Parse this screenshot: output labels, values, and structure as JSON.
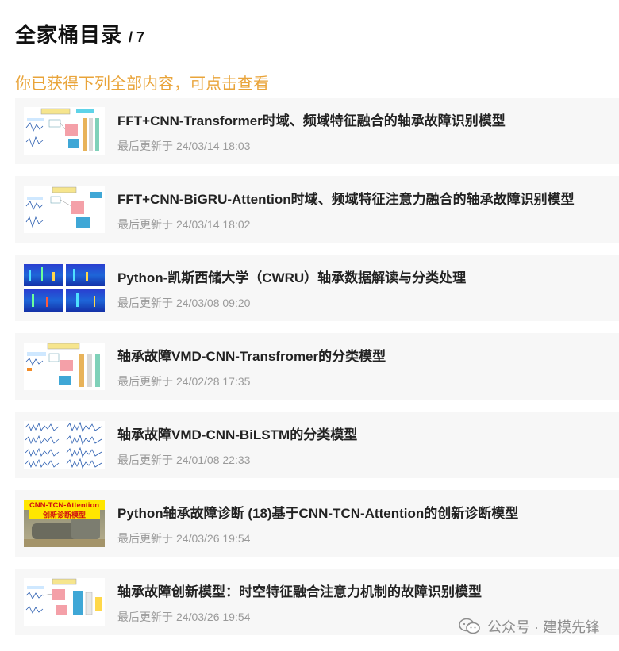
{
  "header": {
    "title": "全家桶目录",
    "count": "/ 7"
  },
  "subtitle": "你已获得下列全部内容，可点击查看",
  "date_label": "最后更新于",
  "items": [
    {
      "title": "FFT+CNN-Transformer时域、频域特征融合的轴承故障识别模型",
      "date": "24/03/14 18:03",
      "thumb": "diagram"
    },
    {
      "title": "FFT+CNN-BiGRU-Attention时域、频域特征注意力融合的轴承故障识别模型",
      "date": "24/03/14 18:02",
      "thumb": "diagram"
    },
    {
      "title": "Python-凯斯西储大学（CWRU）轴承数据解读与分类处理",
      "date": "24/03/08 09:20",
      "thumb": "spectrogram"
    },
    {
      "title": "轴承故障VMD-CNN-Transfromer的分类模型",
      "date": "24/02/28 17:35",
      "thumb": "diagram"
    },
    {
      "title": "轴承故障VMD-CNN-BiLSTM的分类模型",
      "date": "24/01/08 22:33",
      "thumb": "waves"
    },
    {
      "title": "Python轴承故障诊断 (18)基于CNN-TCN-Attention的创新诊断模型",
      "date": "24/03/26 19:54",
      "thumb": "photo",
      "thumb_text_1": "CNN-TCN-Attention",
      "thumb_text_2": "创新诊断模型"
    },
    {
      "title": "轴承故障创新模型：时空特征融合注意力机制的故障识别模型",
      "date": "24/03/26 19:54",
      "thumb": "diagram"
    }
  ],
  "watermark": {
    "text": "公众号 · 建模先锋",
    "icon": "wechat-icon"
  },
  "colors": {
    "accent": "#e9a43a",
    "item_bg": "#f7f7f7",
    "date": "#9a9a9a"
  }
}
